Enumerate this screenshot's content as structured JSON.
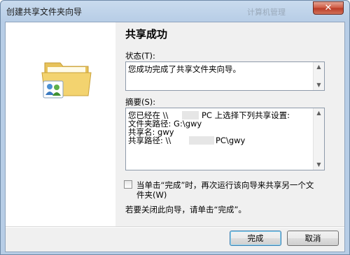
{
  "window": {
    "title": "创建共享文件夹向导",
    "ghost_title": "计算机管理",
    "close_glyph": "✕"
  },
  "icon": "shared-folder-users-icon",
  "heading": "共享成功",
  "status": {
    "label": "状态(T):",
    "text": "您成功完成了共享文件夹向导。"
  },
  "summary": {
    "label": "摘要(S):",
    "lines": [
      "您已经在 \\\\",
      "PC 上选择下列共享设置:",
      "文件夹路径: G:\\gwy",
      "共享名: gwy",
      "共享路径: \\\\",
      "PC\\gwy"
    ]
  },
  "checkbox": {
    "label_line1": "当单击“完成”时，再次运行该向导来共享另一个文",
    "label_line2": "件夹(W)",
    "checked": false
  },
  "close_hint": "若要关闭此向导，请单击“完成”。",
  "buttons": {
    "finish": "完成",
    "cancel": "取消"
  }
}
